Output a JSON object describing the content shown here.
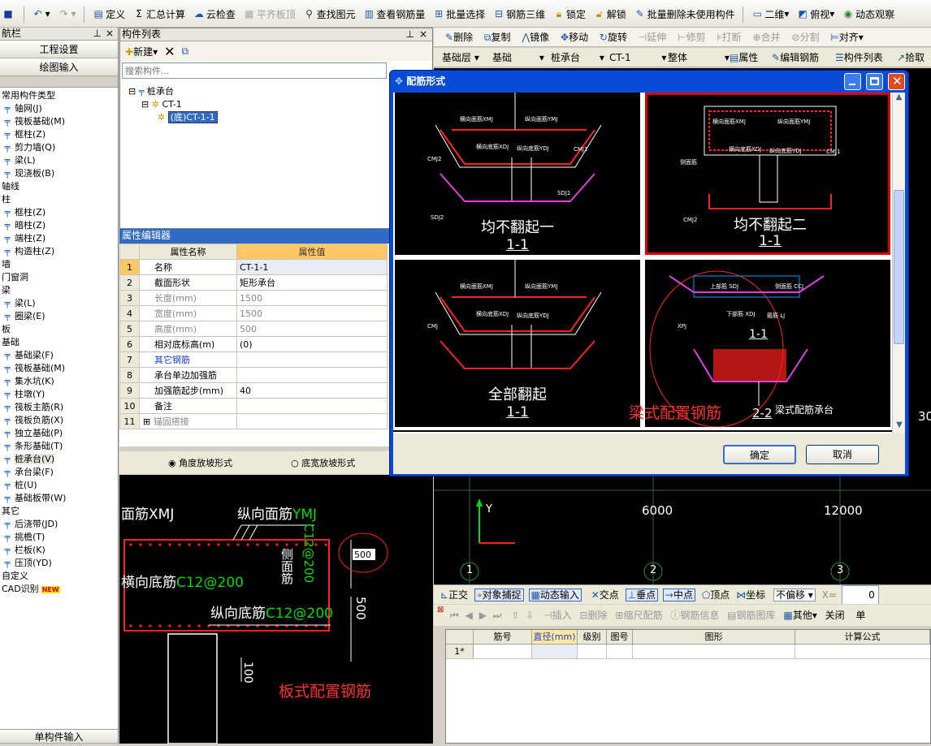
{
  "toolbar": {
    "define": "定义",
    "sum_calc": "汇总计算",
    "cloud_check": "云检查",
    "level_slab": "平齐板顶",
    "find_element": "查找图元",
    "view_rebar_qty": "查看钢筋量",
    "batch_select": "批量选择",
    "rebar_3d": "钢筋三维",
    "lock": "锁定",
    "unlock": "解锁",
    "batch_delete_unused": "批量删除未使用构件",
    "view_2d": "二维",
    "top_view": "俯视",
    "dynamic_view": "动态观察"
  },
  "left_panel": {
    "title": "航栏",
    "project_settings": "工程设置",
    "drawing_input": "绘图输入",
    "tree": [
      {
        "label": "常用构件类型",
        "type": "group"
      },
      {
        "label": "轴网(J)",
        "type": "item"
      },
      {
        "label": "筏板基础(M)",
        "type": "item"
      },
      {
        "label": "框柱(Z)",
        "type": "item"
      },
      {
        "label": "剪力墙(Q)",
        "type": "item"
      },
      {
        "label": "梁(L)",
        "type": "item"
      },
      {
        "label": "现浇板(B)",
        "type": "item"
      },
      {
        "label": "轴线",
        "type": "group"
      },
      {
        "label": "柱",
        "type": "group"
      },
      {
        "label": "框柱(Z)",
        "type": "item"
      },
      {
        "label": "暗柱(Z)",
        "type": "item"
      },
      {
        "label": "端柱(Z)",
        "type": "item"
      },
      {
        "label": "构造柱(Z)",
        "type": "item"
      },
      {
        "label": "墙",
        "type": "group"
      },
      {
        "label": "门窗洞",
        "type": "group"
      },
      {
        "label": "梁",
        "type": "group"
      },
      {
        "label": "梁(L)",
        "type": "item"
      },
      {
        "label": "圈梁(E)",
        "type": "item"
      },
      {
        "label": "板",
        "type": "group"
      },
      {
        "label": "基础",
        "type": "group"
      },
      {
        "label": "基础梁(F)",
        "type": "item"
      },
      {
        "label": "筏板基础(M)",
        "type": "item"
      },
      {
        "label": "集水坑(K)",
        "type": "item"
      },
      {
        "label": "柱墩(Y)",
        "type": "item"
      },
      {
        "label": "筏板主筋(R)",
        "type": "item"
      },
      {
        "label": "筏板负筋(X)",
        "type": "item"
      },
      {
        "label": "独立基础(P)",
        "type": "item"
      },
      {
        "label": "条形基础(T)",
        "type": "item"
      },
      {
        "label": "桩承台(V)",
        "type": "item",
        "selected": true
      },
      {
        "label": "承台梁(F)",
        "type": "item"
      },
      {
        "label": "桩(U)",
        "type": "item"
      },
      {
        "label": "基础板带(W)",
        "type": "item"
      },
      {
        "label": "其它",
        "type": "group"
      },
      {
        "label": "后浇带(JD)",
        "type": "item"
      },
      {
        "label": "挑檐(T)",
        "type": "item"
      },
      {
        "label": "栏板(K)",
        "type": "item"
      },
      {
        "label": "压顶(YD)",
        "type": "item"
      },
      {
        "label": "自定义",
        "type": "group"
      },
      {
        "label": "CAD识别",
        "type": "group",
        "badge": "NEW"
      }
    ],
    "bottom_button": "单构件输入"
  },
  "component_list": {
    "title": "构件列表",
    "new_label": "新建",
    "search_placeholder": "搜索构件...",
    "tree_root": "桩承台",
    "tree_child": "CT-1",
    "tree_leaf": "(底)CT-1-1"
  },
  "property_editor": {
    "title": "属性编辑器",
    "col_name": "属性名称",
    "col_value": "属性值",
    "rows": [
      {
        "num": "1",
        "name": "名称",
        "value": "CT-1-1"
      },
      {
        "num": "2",
        "name": "截面形状",
        "value": "矩形承台"
      },
      {
        "num": "3",
        "name": "长度(mm)",
        "value": "1500"
      },
      {
        "num": "4",
        "name": "宽度(mm)",
        "value": "1500"
      },
      {
        "num": "5",
        "name": "高度(mm)",
        "value": "500"
      },
      {
        "num": "6",
        "name": "相对底标高(m)",
        "value": "(0)"
      },
      {
        "num": "7",
        "name": "其它钢筋",
        "value": ""
      },
      {
        "num": "8",
        "name": "承台单边加强筋",
        "value": ""
      },
      {
        "num": "9",
        "name": "加强筋起步(mm)",
        "value": "40"
      },
      {
        "num": "10",
        "name": "备注",
        "value": ""
      },
      {
        "num": "11",
        "name": "锚固搭接",
        "value": ""
      }
    ],
    "radio_angle": "角度放坡形式",
    "radio_width": "底宽放坡形式"
  },
  "preview": {
    "top_bar": "面筋XMJ",
    "long_top": "纵向面筋",
    "long_top_code": "YMJ",
    "trans_bottom": "横向底筋",
    "trans_bottom_code": "C12@200",
    "long_bottom": "纵向底筋",
    "long_bottom_code": "C12@200",
    "side_bar": "侧面筋",
    "side_code": "C12@200",
    "dim_500a": "500",
    "dim_500b": "500",
    "dim_100": "100",
    "input_value": "500",
    "slab_label": "板式配置钢筋"
  },
  "right_toolbar1": {
    "delete": "删除",
    "copy": "复制",
    "mirror": "镜像",
    "move": "移动",
    "rotate": "旋转",
    "extend": "延伸",
    "trim": "修剪",
    "break": "打断",
    "merge": "合并",
    "split": "分割",
    "align": "对齐"
  },
  "right_toolbar2": {
    "floor": "基础层",
    "layer": "基础",
    "type": "桩承台",
    "element": "CT-1",
    "whole": "整体",
    "attributes": "属性",
    "edit_rebar": "编辑钢筋",
    "component_list": "构件列表",
    "pick": "拾取"
  },
  "cad": {
    "axis_y": "Y",
    "dim1": "6000",
    "dim2": "12000",
    "dim_edge": "30",
    "axis_1": "1",
    "axis_2": "2",
    "axis_3": "3"
  },
  "snap_bar": {
    "orthogonal": "正交",
    "object_snap": "对象捕捉",
    "dynamic_input": "动态输入",
    "intersection": "交点",
    "perpendicular": "垂点",
    "midpoint": "中点",
    "vertex": "顶点",
    "coordinate": "坐标",
    "no_offset": "不偏移",
    "x_label": "X=",
    "x_value": "0"
  },
  "rebar_table": {
    "insert": "插入",
    "delete": "删除",
    "scale_rebar": "缩尺配筋",
    "rebar_info": "钢筋信息",
    "rebar_library": "钢筋图库",
    "other": "其他",
    "close": "关闭",
    "single": "单",
    "headers": [
      "筋号",
      "直径(mm)",
      "级别",
      "图号",
      "图形",
      "计算公式"
    ],
    "row_marker": "1*"
  },
  "dialog": {
    "title": "配筋形式",
    "ok": "确定",
    "cancel": "取消",
    "panels": [
      {
        "caption": "均不翻起一",
        "section": "1-1",
        "labels": [
          "横向面筋XMJ",
          "纵向面筋YMJ",
          "横向底筋XDJ",
          "纵向底筋YDJ",
          "CMJ2",
          "CMJ1",
          "SDJ2",
          "SDJ1"
        ]
      },
      {
        "caption": "均不翻起二",
        "section": "1-1",
        "labels": [
          "横向面筋XMJ",
          "纵向面筋YMJ",
          "横向底筋XDJ",
          "纵向底筋YDJ",
          "侧面筋",
          "CMJ1",
          "CMJ2"
        ]
      },
      {
        "caption": "全部翻起",
        "section": "1-1",
        "labels": [
          "横向面筋XMJ",
          "纵向面筋YMJ",
          "横向底筋XDJ",
          "纵向底筋YDJ",
          "CMJ"
        ]
      },
      {
        "caption": "梁式配筋承台",
        "section_a": "1-1",
        "section_b": "2-2",
        "labels": [
          "上部筋 SDJ",
          "侧面筋 CCJ",
          "下部筋 XDJ",
          "箍筋 LJ",
          "XPJ"
        ],
        "overlay": "梁式配置钢筋"
      }
    ]
  }
}
